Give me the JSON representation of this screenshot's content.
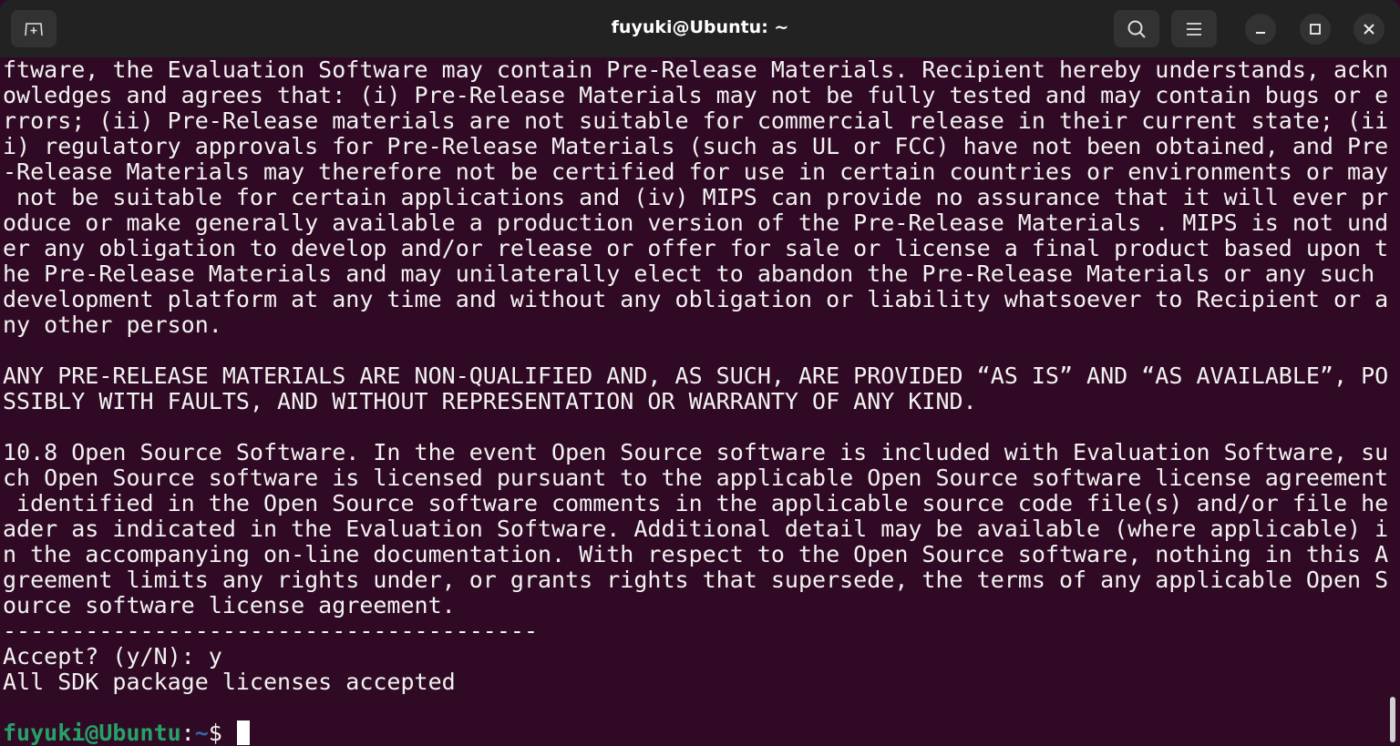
{
  "window": {
    "title": "fuyuki@Ubuntu: ~"
  },
  "terminal": {
    "lines": [
      "ftware, the Evaluation Software may contain Pre-Release Materials. Recipient hereby understands, ackn",
      "owledges and agrees that: (i) Pre-Release Materials may not be fully tested and may contain bugs or e",
      "rrors; (ii) Pre-Release materials are not suitable for commercial release in their current state; (ii",
      "i) regulatory approvals for Pre-Release Materials (such as UL or FCC) have not been obtained, and Pre",
      "-Release Materials may therefore not be certified for use in certain countries or environments or may",
      " not be suitable for certain applications and (iv) MIPS can provide no assurance that it will ever pr",
      "oduce or make generally available a production version of the Pre-Release Materials . MIPS is not und",
      "er any obligation to develop and/or release or offer for sale or license a final product based upon t",
      "he Pre-Release Materials and may unilaterally elect to abandon the Pre-Release Materials or any such",
      "development platform at any time and without any obligation or liability whatsoever to Recipient or a",
      "ny other person.",
      "",
      "ANY PRE-RELEASE MATERIALS ARE NON-QUALIFIED AND, AS SUCH, ARE PROVIDED “AS IS” AND “AS AVAILABLE”, PO",
      "SSIBLY WITH FAULTS, AND WITHOUT REPRESENTATION OR WARRANTY OF ANY KIND.",
      "",
      "10.8 Open Source Software. In the event Open Source software is included with Evaluation Software, su",
      "ch Open Source software is licensed pursuant to the applicable Open Source software license agreement",
      " identified in the Open Source software comments in the applicable source code file(s) and/or file he",
      "ader as indicated in the Evaluation Software. Additional detail may be available (where applicable) i",
      "n the accompanying on-line documentation. With respect to the Open Source software, nothing in this A",
      "greement limits any rights under, or grants rights that supersede, the terms of any applicable Open S",
      "ource software license agreement.",
      "---------------------------------------",
      "Accept? (y/N): y",
      "All SDK package licenses accepted",
      ""
    ],
    "prompt": {
      "user_host": "fuyuki@Ubuntu",
      "sep": ":",
      "path": "~",
      "symbol": "$ "
    }
  }
}
